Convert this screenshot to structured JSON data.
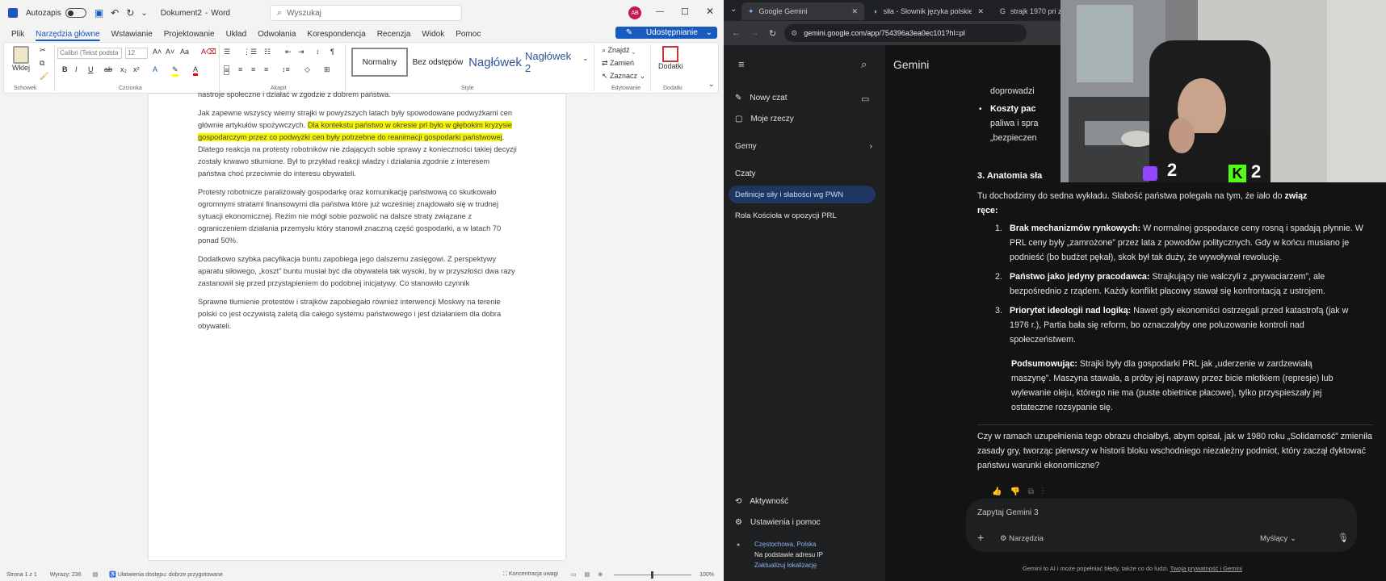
{
  "word": {
    "title": {
      "autosave": "Autozapis",
      "doc_name": "Dokument2",
      "app": "Word",
      "search_placeholder": "Wyszukaj",
      "avatar": "AB"
    },
    "menu": [
      "Plik",
      "Narzędzia główne",
      "Wstawianie",
      "Projektowanie",
      "Układ",
      "Odwołania",
      "Korespondencja",
      "Recenzja",
      "Widok",
      "Pomoc"
    ],
    "share": "Udostępnianie",
    "ribbon": {
      "paste": "Wklej",
      "font_name": "Calibri (Tekst podsta",
      "font_size": "12",
      "groups": {
        "clipboard": "Schowek",
        "font": "Czcionka",
        "paragraph": "Akapit",
        "styles": "Style",
        "editing": "Edytowanie",
        "addins": "Dodatki"
      },
      "styles": [
        "Normalny",
        "Bez odstępów",
        "Nagłówek",
        "Nagłówek 2"
      ],
      "editing": [
        "Znajdź",
        "Zamień",
        "Zaznacz"
      ],
      "addins": "Dodatki"
    },
    "document": {
      "p0": "nastroje społeczne i działać w zgodzie z dobrem państwa.",
      "p1_a": "Jak zapewne wszyscy wiemy strajki w powyższych latach były spowodowane podwyżkami cen głównie artykułów spożywczych. ",
      "p1_hl": "Dla kontekstu państwo w okresie prl było w głębokim kryzysie gospodarczym przez co podwyżki cen były potrzebne do reanimacji gospodarki państwowej",
      "p1_b": ". Dlatego reakcja na protesty robotników nie zdających sobie sprawy z konieczności takiej decyzji zostały krwawo stłumione. Był to przykład reakcji władzy i działania zgodnie z interesem państwa choć przeciwnie do interesu obywateli.",
      "p2": "Protesty robotnicze paraliżowały gospodarkę oraz komunikację państwową co skutkowało ogromnymi stratami finansowymi dla państwa które już wcześniej znajdowało się w trudnej sytuacji ekonomicznej. Reżim nie mógł sobie pozwolić na dalsze straty związane z ograniczeniem działania przemysłu który stanowił znaczną część gospodarki, a w latach 70 ponad 50%.",
      "p3": "Dodatkowo szybka pacyfikacja buntu zapobiega jego dalszemu zasięgowi. Z perspektywy aparatu siłowego, „koszt” buntu musiał być dla obywatela tak wysoki, by w przyszłości dwa razy zastanowił się przed przystąpieniem do podobnej inicjatywy. Co stanowiło czynnik",
      "p4": "Sprawne tłumienie protestów i strajków zapobiegało również interwencji Moskwy na terenie polski co jest oczywistą zaletą dla całego systemu państwowego i jest działaniem dla dobra obywateli."
    },
    "status": {
      "page": "Strona 1 z 1",
      "words": "Wyrazy: 236",
      "accessibility": "Ułatwienia dostępu: dobrze przygotowane",
      "focus": "Koncentracja uwagi",
      "zoom": "100%"
    }
  },
  "chrome": {
    "tabs": [
      "Google Gemini",
      "siła - Słownik języka polskiego",
      "strajk 1970 pri zez"
    ],
    "url": "gemini.google.com/app/754396a3ea0ec101?hl=pl",
    "sidebar": {
      "new_chat": "Nowy czat",
      "my_stuff": "Moje rzeczy",
      "gems": "Gemy",
      "chats": "Czaty",
      "chat_items": [
        "Definicje siły i słabości wg PWN",
        "Rola Kościoła w opozycji PRL"
      ],
      "activity": "Aktywność",
      "settings": "Ustawienia i pomoc",
      "location": "Częstochowa, Polska",
      "location_basis": "Na podstawie adresu IP",
      "update_location": "Zaktualizuj lokalizację"
    },
    "header": "Gemini",
    "response": {
      "frag1": "doprowadzi",
      "bullet_title": "Koszty pac",
      "bullet_line2": "paliwa i spra",
      "bullet_line3": "„bezpieczen",
      "h3": "3. Anatomia sła",
      "intro": "Tu dochodzimy do sedna wykładu. Słabość państwa polegała na tym, że",
      "intro_tail": "iało do",
      "intro_bold": "związ",
      "intro_bold2": "ręce",
      "items": [
        {
          "num": "1.",
          "title": "Brak mechanizmów rynkowych:",
          "text": " W normalnej gospodarce ceny rosną i spadają płynnie. W PRL ceny były „zamrożone” przez lata z powodów politycznych. Gdy w końcu musiano je podnieść (bo budżet pękał), skok był tak duży, że wywoływał rewolucję."
        },
        {
          "num": "2.",
          "title": "Państwo jako jedyny pracodawca:",
          "text": " Strajkujący nie walczyli z „prywaciarzem”, ale bezpośrednio z rządem. Każdy konflikt płacowy stawał się konfrontacją z ustrojem."
        },
        {
          "num": "3.",
          "title": "Priorytet ideologii nad logiką:",
          "text": " Nawet gdy ekonomiści ostrzegali przed katastrofą (jak w 1976 r.), Partia bała się reform, bo oznaczałyby one poluzowanie kontroli nad społeczeństwem."
        }
      ],
      "summary_title": "Podsumowując:",
      "summary_text": " Strajki były dla gospodarki PRL jak „uderzenie w zardzewiałą maszynę”. Maszyna stawała, a próby jej naprawy przez bicie młotkiem (represje) lub wylewanie oleju, którego nie ma (puste obietnice płacowe), tylko przyspieszały jej ostateczne rozsypanie się.",
      "question": "Czy w ramach uzupełnienia tego obrazu chciałbyś, abym opisał, jak w 1980 roku „Solidarność” zmieniła zasady gry, tworząc pierwszy w historii bloku wschodniego niezależny podmiot, który zaczął dyktować państwu warunki ekonomiczne?"
    },
    "input": {
      "placeholder": "Zapytaj Gemini 3",
      "tools": "Narzędzia",
      "mode": "Myślący"
    },
    "disclaimer": "Gemini to AI i może popełniać błędy, także co do ludzi.",
    "privacy_link": "Twoja prywatność i Gemini"
  },
  "overlay": {
    "left_count": "2",
    "right_count": "2"
  }
}
